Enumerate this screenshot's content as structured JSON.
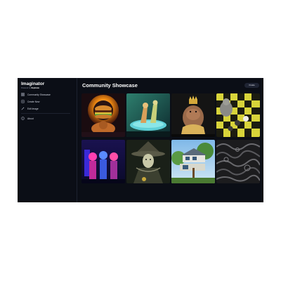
{
  "app": {
    "name": "Imaginator",
    "tagline_prefix": "Powered by",
    "tagline_brand": "Replicate"
  },
  "sidebar": {
    "items": [
      {
        "label": "Community Showcase",
        "icon": "grid-icon"
      },
      {
        "label": "Create New",
        "icon": "plus-square-icon"
      },
      {
        "label": "Edit Image",
        "icon": "wand-icon"
      }
    ],
    "secondary": [
      {
        "label": "About",
        "icon": "info-icon"
      }
    ]
  },
  "main": {
    "title": "Community Showcase",
    "create_label": "Create",
    "gallery": [
      {
        "subject": "burger-portal"
      },
      {
        "subject": "figures-on-stage"
      },
      {
        "subject": "crowned-capybara"
      },
      {
        "subject": "chessboard-cat"
      },
      {
        "subject": "neon-figures"
      },
      {
        "subject": "wizard-witch"
      },
      {
        "subject": "treehouse"
      },
      {
        "subject": "dark-pattern"
      }
    ]
  },
  "colors": {
    "background": "#0b0e16",
    "accent": "#ffffff",
    "button": "#1f2433"
  }
}
